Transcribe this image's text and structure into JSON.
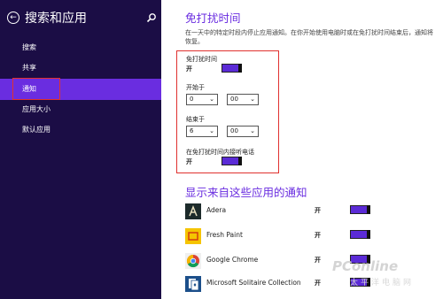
{
  "sidebar": {
    "title": "搜索和应用",
    "items": [
      {
        "label": "搜索"
      },
      {
        "label": "共享"
      },
      {
        "label": "通知"
      },
      {
        "label": "应用大小"
      },
      {
        "label": "默认应用"
      }
    ]
  },
  "quiet_hours": {
    "title": "免打扰时间",
    "description": "在一天中的特定时段内停止应用通知。在你开始使用电脑时或在免打扰时间结束后，通知将恢复。",
    "toggle_label": "免打扰时间",
    "toggle_state": "开",
    "start_label": "开始于",
    "start_hour": "0",
    "start_minute": "00",
    "end_label": "结束于",
    "end_hour": "6",
    "end_minute": "00",
    "calls_label": "在免打扰时间内接听电话",
    "calls_state": "开"
  },
  "apps_section": {
    "title": "显示来自这些应用的通知",
    "apps": [
      {
        "name": "Adera",
        "state": "开",
        "icon": "adera-icon"
      },
      {
        "name": "Fresh Paint",
        "state": "开",
        "icon": "fresh-paint-icon"
      },
      {
        "name": "Google Chrome",
        "state": "开",
        "icon": "chrome-icon"
      },
      {
        "name": "Microsoft Solitaire Collection",
        "state": "开",
        "icon": "solitaire-icon"
      }
    ]
  },
  "watermark": {
    "text": "PConline",
    "sub": "太平洋电脑网"
  },
  "colors": {
    "sidebar_bg": "#1b0d45",
    "accent": "#6a2de0",
    "highlight_box": "#e0312f"
  }
}
